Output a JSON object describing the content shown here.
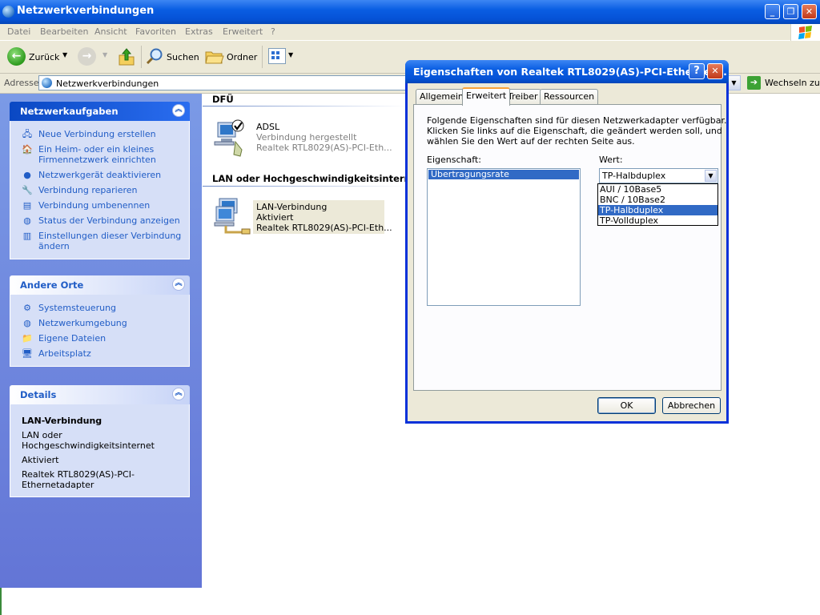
{
  "window": {
    "title": "Netzwerkverbindungen",
    "controls": {
      "minimize": "_",
      "maximize": "❐",
      "close": "✕"
    }
  },
  "menu": [
    "Datei",
    "Bearbeiten",
    "Ansicht",
    "Favoriten",
    "Extras",
    "Erweitert",
    "?"
  ],
  "toolbar": {
    "back": "Zurück",
    "search": "Suchen",
    "folders": "Ordner"
  },
  "address": {
    "label": "Adresse",
    "value": "Netzwerkverbindungen",
    "go": "Wechseln zu"
  },
  "taskpane": {
    "network_tasks": {
      "title": "Netzwerkaufgaben",
      "items": [
        "Neue Verbindung erstellen",
        "Ein Heim- oder ein kleines Firmennetzwerk einrichten",
        "Netzwerkgerät deaktivieren",
        "Verbindung reparieren",
        "Verbindung umbenennen",
        "Status der Verbindung anzeigen",
        "Einstellungen dieser Verbindung ändern"
      ]
    },
    "other_places": {
      "title": "Andere Orte",
      "items": [
        "Systemsteuerung",
        "Netzwerkumgebung",
        "Eigene Dateien",
        "Arbeitsplatz"
      ]
    },
    "details": {
      "title": "Details",
      "name": "LAN-Verbindung",
      "type": "LAN oder Hochgeschwindigkeitsinternet",
      "status": "Aktiviert",
      "adapter": "Realtek RTL8029(AS)-PCI-Ethernetadapter"
    }
  },
  "content": {
    "group_dfu": "DFÜ",
    "group_lan": "LAN oder Hochgeschwindigkeitsinternet",
    "adsl": {
      "name": "ADSL",
      "status": "Verbindung hergestellt",
      "device": "Realtek RTL8029(AS)-PCI-Eth..."
    },
    "lan": {
      "name": "LAN-Verbindung",
      "status": "Aktiviert",
      "device": "Realtek RTL8029(AS)-PCI-Eth..."
    }
  },
  "dialog": {
    "title": "Eigenschaften von Realtek RTL8029(AS)-PCI-Ethernet...",
    "help": "?",
    "close": "✕",
    "tabs": [
      "Allgemein",
      "Erweitert",
      "Treiber",
      "Ressourcen"
    ],
    "active_tab": "Erweitert",
    "description": [
      "Folgende Eigenschaften sind für diesen Netzwerkadapter verfügbar.",
      "Klicken Sie links auf die Eigenschaft, die geändert werden soll, und",
      "wählen Sie den Wert auf der rechten Seite aus."
    ],
    "property_label": "Eigenschaft:",
    "value_label": "Wert:",
    "properties": [
      "Übertragungsrate"
    ],
    "selected_value": "TP-Halbduplex",
    "options": [
      "AUI / 10Base5",
      "BNC / 10Base2",
      "TP-Halbduplex",
      "TP-Vollduplex"
    ],
    "ok": "OK",
    "cancel": "Abbrechen"
  }
}
